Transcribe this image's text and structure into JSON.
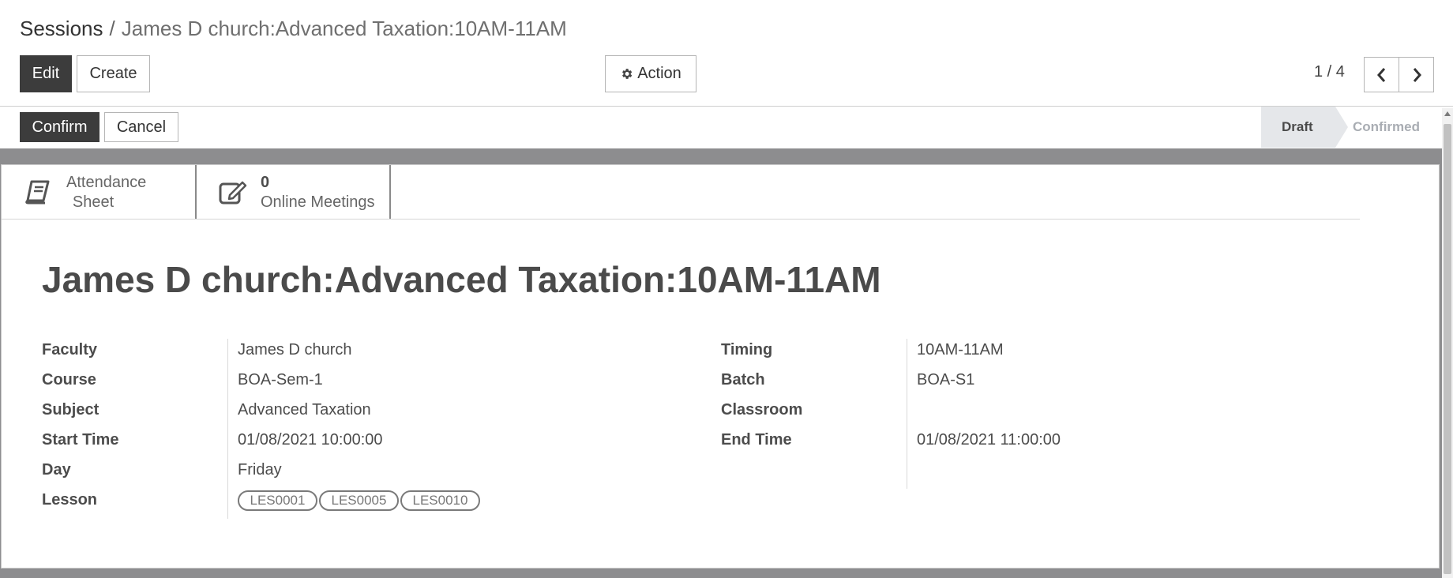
{
  "breadcrumb": {
    "root": "Sessions",
    "separator": "/",
    "current": "James D church:Advanced Taxation:10AM-11AM"
  },
  "toolbar": {
    "edit_label": "Edit",
    "create_label": "Create",
    "action_label": "Action"
  },
  "pager": {
    "value": "1 / 4"
  },
  "statusbar": {
    "confirm_label": "Confirm",
    "cancel_label": "Cancel",
    "steps": [
      "Draft",
      "Confirmed"
    ],
    "current_step": "Draft"
  },
  "smart_buttons": {
    "attendance": {
      "label_line1": "Attendance",
      "label_line2": "Sheet"
    },
    "meetings": {
      "count": "0",
      "label": "Online Meetings"
    }
  },
  "record": {
    "title": "James D church:Advanced Taxation:10AM-11AM",
    "left_fields": [
      {
        "label": "Faculty",
        "value": "James D church"
      },
      {
        "label": "Course",
        "value": "BOA-Sem-1"
      },
      {
        "label": "Subject",
        "value": "Advanced Taxation"
      },
      {
        "label": "Start Time",
        "value": "01/08/2021 10:00:00"
      },
      {
        "label": "Day",
        "value": "Friday"
      },
      {
        "label": "Lesson",
        "value": ""
      }
    ],
    "right_fields": [
      {
        "label": "Timing",
        "value": "10AM-11AM"
      },
      {
        "label": "Batch",
        "value": "BOA-S1"
      },
      {
        "label": "Classroom",
        "value": ""
      },
      {
        "label": "End Time",
        "value": "01/08/2021 11:00:00"
      }
    ],
    "lessons": [
      "LES0001",
      "LES0005",
      "LES0010"
    ]
  },
  "colors": {
    "primary_dark": "#3c3c3c",
    "status_active_bg": "#e5e7ea",
    "status_inactive_text": "#a9adb3",
    "background_band": "#8d8d8f"
  }
}
